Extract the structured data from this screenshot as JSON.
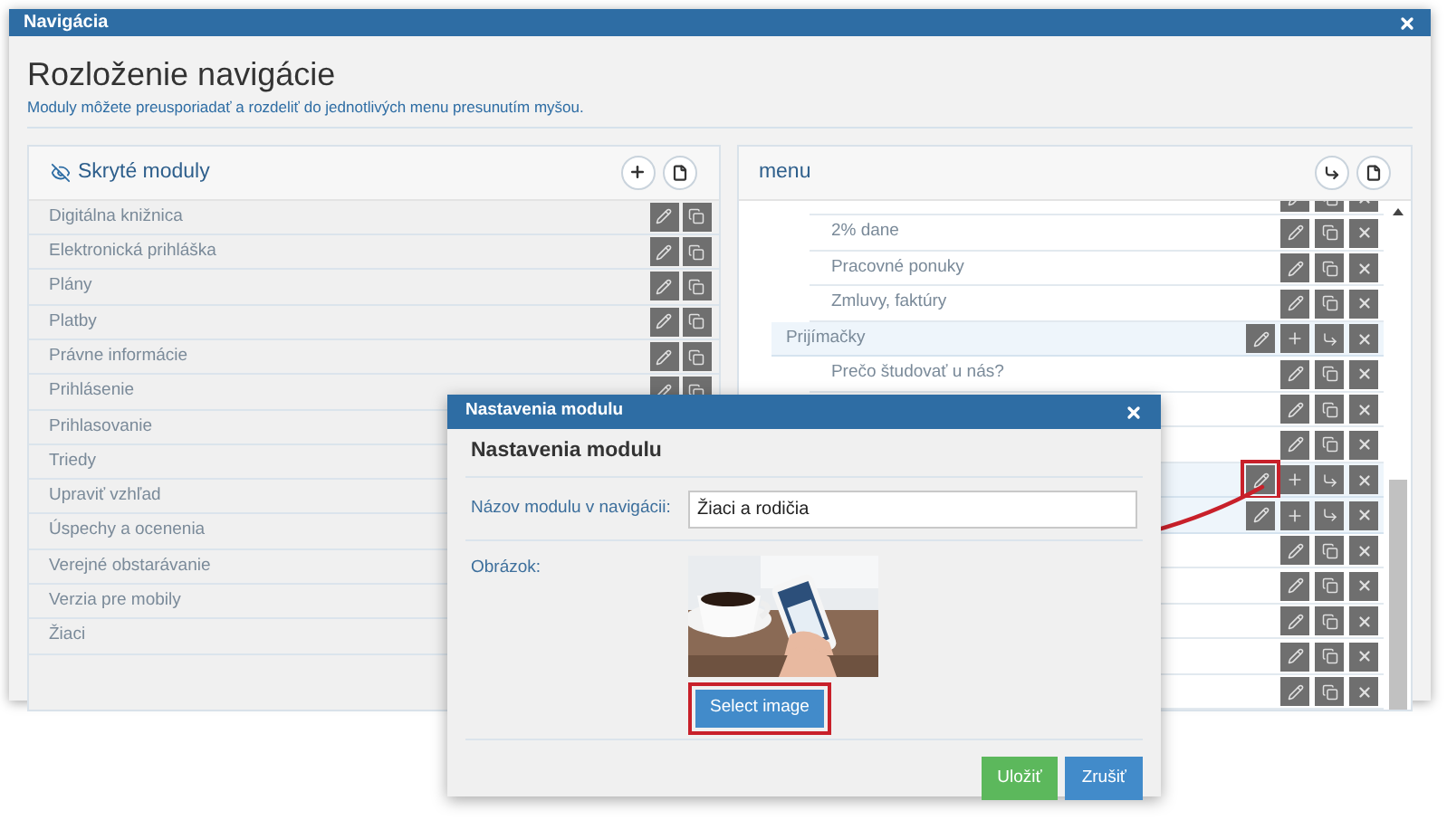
{
  "window": {
    "title": "Navigácia"
  },
  "heading": "Rozloženie navigácie",
  "subtitle": "Moduly môžete preusporiadať a rozdeliť do jednotlivých menu presunutím myšou.",
  "hidden_modules": {
    "title": "Skryté moduly",
    "items": [
      {
        "label": "Digitálna knižnica",
        "kind": "editable"
      },
      {
        "label": "Elektronická prihláška",
        "kind": "editable"
      },
      {
        "label": "Plány",
        "kind": "editable"
      },
      {
        "label": "Platby",
        "kind": "editable"
      },
      {
        "label": "Právne informácie",
        "kind": "editable"
      },
      {
        "label": "Prihlásenie",
        "kind": "editable"
      },
      {
        "label": "Prihlasovanie",
        "kind": "plain"
      },
      {
        "label": "Triedy",
        "kind": "plain"
      },
      {
        "label": "Upraviť vzhľad",
        "kind": "plain"
      },
      {
        "label": "Úspechy a ocenenia",
        "kind": "plain"
      },
      {
        "label": "Verejné obstarávanie",
        "kind": "plain"
      },
      {
        "label": "Verzia pre mobily",
        "kind": "plain"
      },
      {
        "label": "Žiaci",
        "kind": "plain"
      }
    ]
  },
  "menu": {
    "title": "menu",
    "rows": [
      {
        "kind": "leaf"
      },
      {
        "kind": "leaf",
        "label": "2% dane"
      },
      {
        "kind": "leaf",
        "label": "Pracovné ponuky"
      },
      {
        "kind": "leaf",
        "label": "Zmluvy, faktúry"
      },
      {
        "kind": "group",
        "label": "Prijímačky"
      },
      {
        "kind": "leaf",
        "label": "Prečo študovať u nás?"
      },
      {
        "kind": "leaf"
      },
      {
        "kind": "leaf"
      },
      {
        "kind": "group",
        "highlighted": true
      },
      {
        "kind": "group"
      },
      {
        "kind": "leaf"
      },
      {
        "kind": "leaf"
      },
      {
        "kind": "leaf"
      },
      {
        "kind": "leaf"
      },
      {
        "kind": "leaf"
      }
    ]
  },
  "modal": {
    "title": "Nastavenia modulu",
    "heading": "Nastavenia modulu",
    "name_label": "Názov modulu v navigácii:",
    "name_value": "Žiaci a rodičia",
    "image_label": "Obrázok:",
    "select_button": {
      "label": "Select image",
      "highlighted": true
    },
    "buttons": [
      {
        "label": "Uložiť",
        "kind": "primary"
      },
      {
        "label": "Zrušiť",
        "kind": "secondary"
      }
    ]
  }
}
